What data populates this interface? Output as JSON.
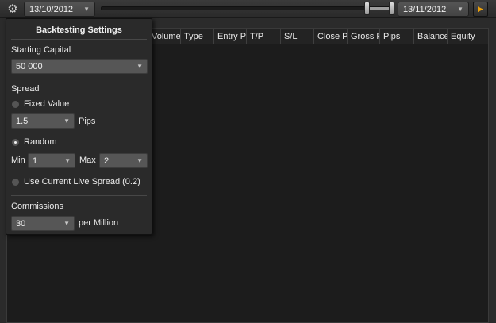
{
  "toolbar": {
    "date_from": "13/10/2012",
    "date_to": "13/11/2012",
    "slider": {
      "start_fraction": 0.91,
      "end_fraction": 1.0
    }
  },
  "grid": {
    "columns": [
      "Volume",
      "Type",
      "Entry Pr",
      "T/P",
      "S/L",
      "Close P",
      "Gross P",
      "Pips",
      "Balance",
      "Equity"
    ]
  },
  "popup": {
    "title": "Backtesting Settings",
    "starting_capital_label": "Starting Capital",
    "starting_capital_value": "50 000",
    "spread_label": "Spread",
    "fixed_value_label": "Fixed Value",
    "fixed_value": "1.5",
    "pips_label": "Pips",
    "random_label": "Random",
    "min_label": "Min",
    "min_value": "1",
    "max_label": "Max",
    "max_value": "2",
    "live_spread_label": "Use Current Live Spread (0.2)",
    "commissions_label": "Commissions",
    "commissions_value": "30",
    "per_million_label": "per Million",
    "selected_spread": "random"
  },
  "colors": {
    "accent": "#f0a30a",
    "background": "#2b2b2b",
    "panel": "#2a2a2a"
  },
  "icons": {
    "settings": "gear-icon",
    "dropdown": "chevron-down-icon",
    "run": "play-icon"
  }
}
